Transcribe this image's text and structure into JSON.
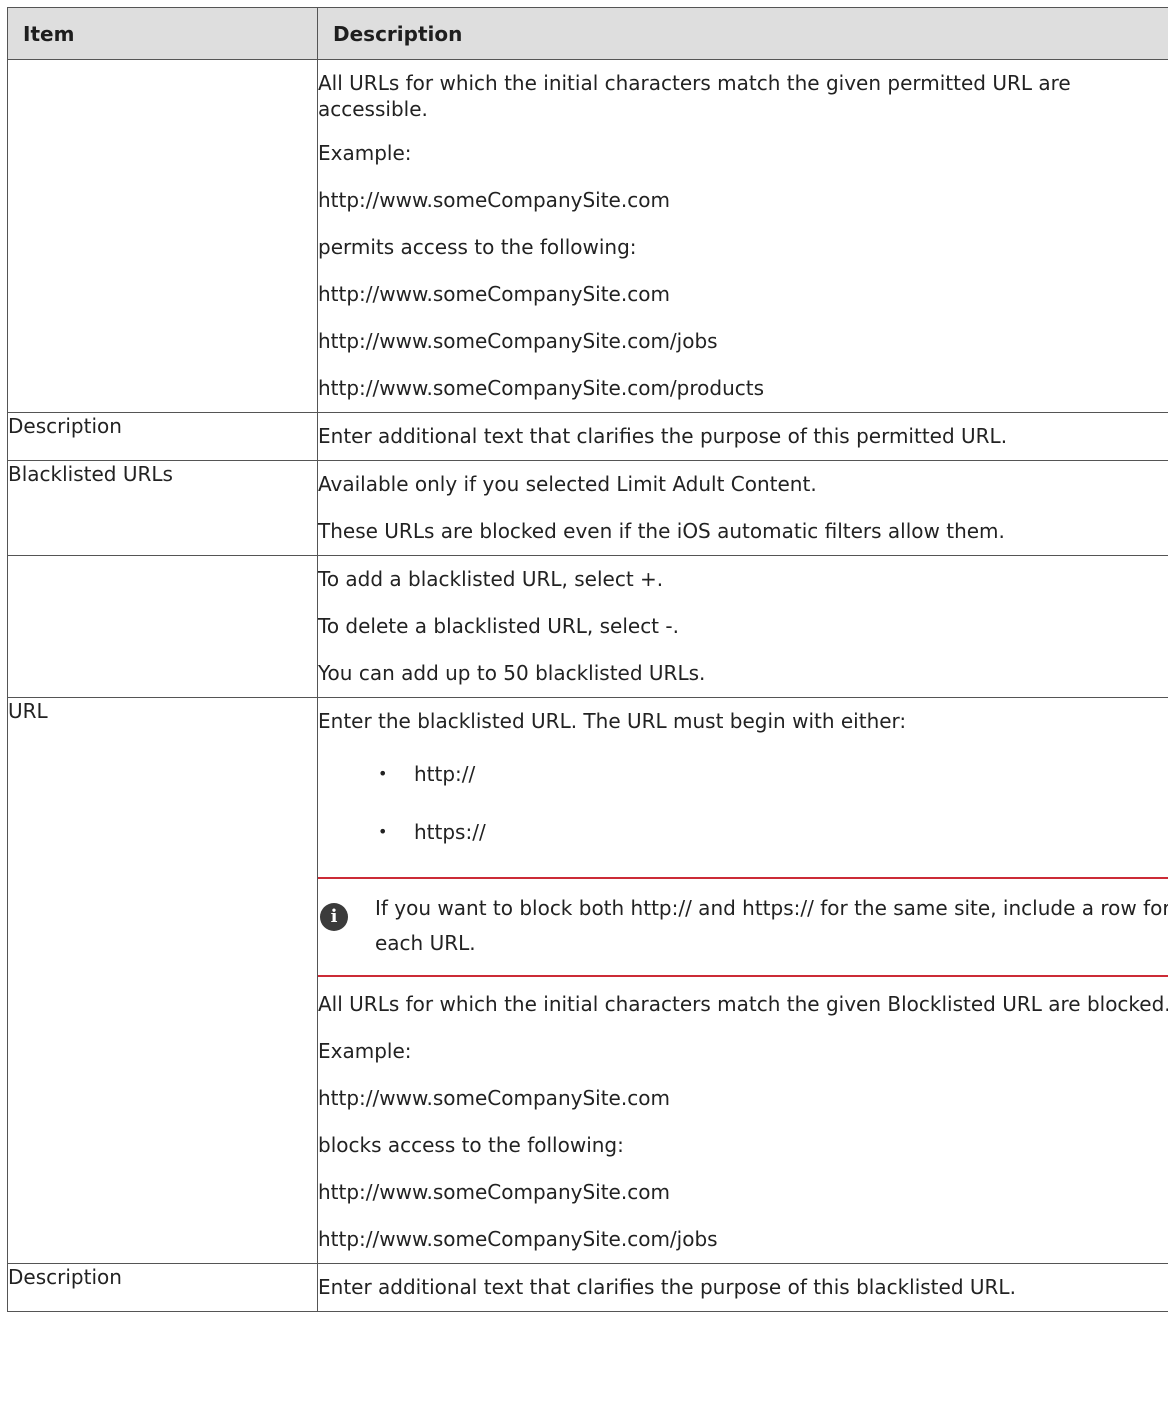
{
  "table": {
    "headers": {
      "item": "Item",
      "description": "Description"
    },
    "rows": [
      {
        "item": "",
        "description": [
          "All URLs for which the initial characters match the given permitted URL are accessible.",
          "Example:",
          "http://www.someCompanySite.com",
          "permits access to the following:",
          "http://www.someCompanySite.com",
          "http://www.someCompanySite.com/jobs",
          "http://www.someCompanySite.com/products"
        ]
      },
      {
        "item": "Description",
        "description": [
          "Enter additional text that clarifies the purpose of this permitted URL."
        ]
      },
      {
        "item": "Blacklisted URLs",
        "description": [
          "Available only if you selected Limit Adult Content.",
          "These URLs are blocked even if the iOS automatic filters allow them."
        ]
      },
      {
        "item": "",
        "description": [
          "To add a blacklisted URL, select +.",
          "To delete a blacklisted URL, select -.",
          "You can add up to 50 blacklisted URLs."
        ]
      },
      {
        "item": "URL",
        "intro": "Enter the blacklisted URL. The URL must begin with either:",
        "bullets": [
          "http://",
          "https://"
        ],
        "note": "If you want to block both http:// and https:// for the same site, include a row for each URL.",
        "description": [
          "All URLs for which the initial characters match the given Blocklisted URL are blocked.",
          "Example:",
          "http://www.someCompanySite.com",
          "blocks access to the following:",
          "http://www.someCompanySite.com",
          "http://www.someCompanySite.com/jobs"
        ]
      },
      {
        "item": "Description",
        "description": [
          "Enter additional text that clarifies the purpose of this blacklisted URL."
        ]
      }
    ]
  },
  "icons": {
    "note": "info-icon",
    "bullet": "•"
  },
  "colors": {
    "header_bg": "#dedede",
    "note_rule": "#cc2b36",
    "border": "#555555"
  }
}
